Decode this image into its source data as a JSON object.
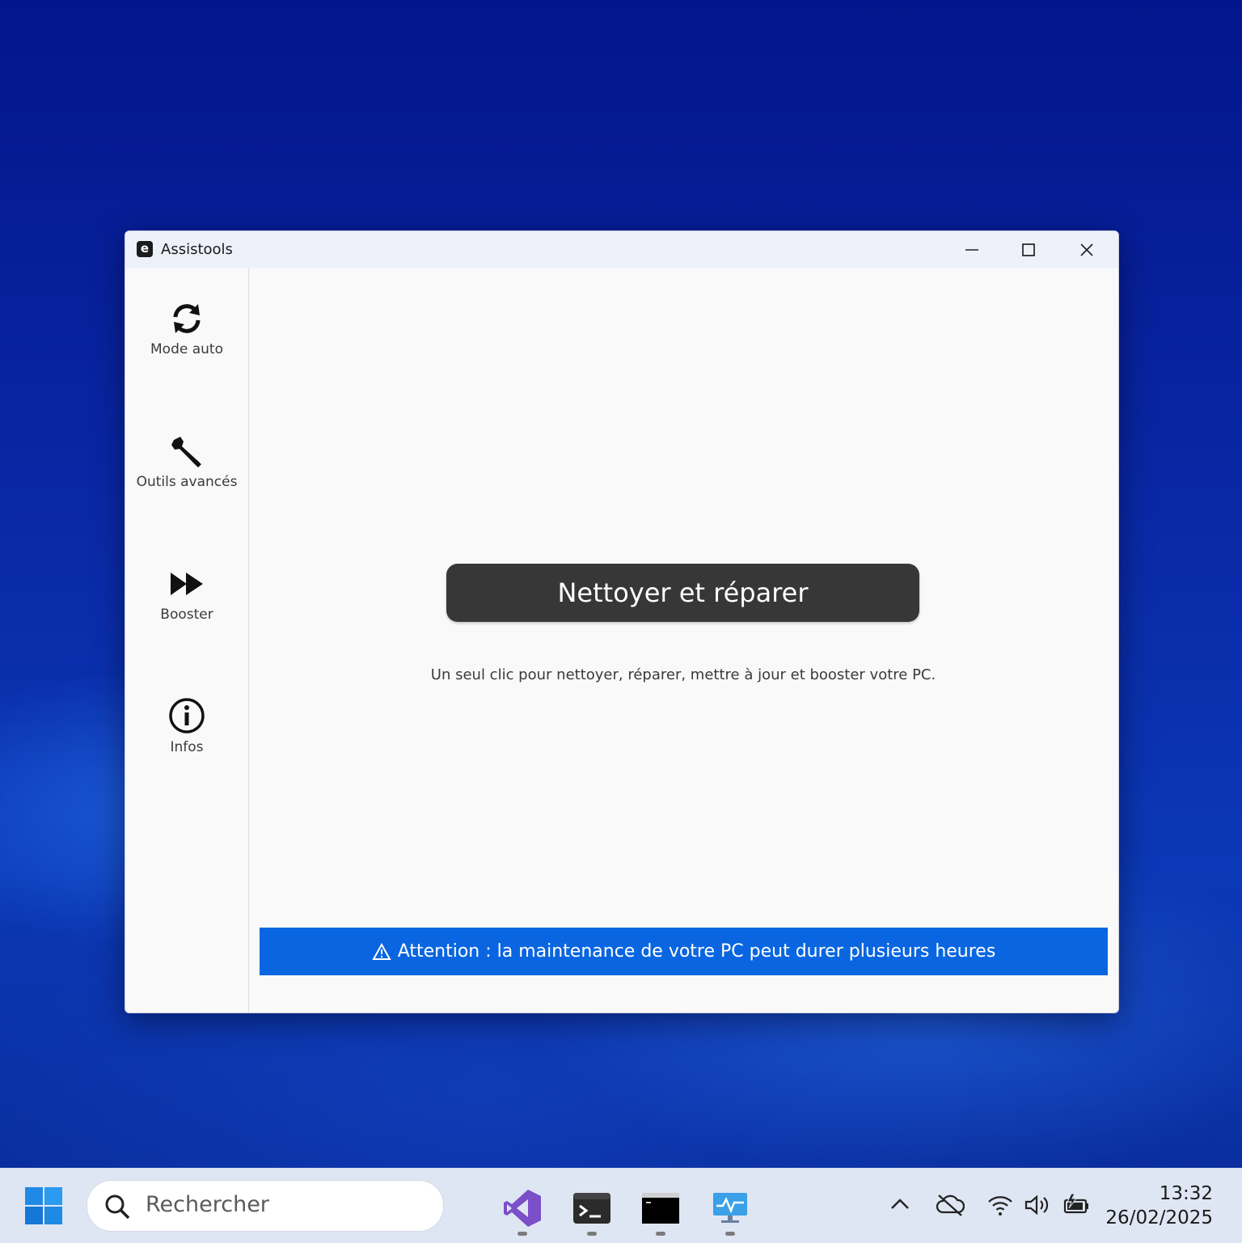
{
  "window": {
    "title": "Assistools",
    "logo_letter": "e"
  },
  "sidebar": {
    "items": [
      {
        "label": "Mode auto",
        "icon": "sync-icon"
      },
      {
        "label": "Outils avancés",
        "icon": "wrench-icon"
      },
      {
        "label": "Booster",
        "icon": "fast-forward-icon"
      },
      {
        "label": "Infos",
        "icon": "info-icon"
      }
    ]
  },
  "main": {
    "action_label": "Nettoyer et réparer",
    "description": "Un seul clic pour nettoyer, réparer, mettre à jour et booster votre PC.",
    "warning": "Attention : la maintenance de votre PC peut durer plusieurs heures"
  },
  "taskbar": {
    "search_placeholder": "Rechercher",
    "pinned_apps": [
      "visual-studio-icon",
      "terminal-icon",
      "command-prompt-icon",
      "monitor-icon"
    ],
    "time": "13:32",
    "date": "26/02/2025"
  },
  "colors": {
    "accent_warning": "#0a66e0",
    "action_button": "#373737"
  }
}
